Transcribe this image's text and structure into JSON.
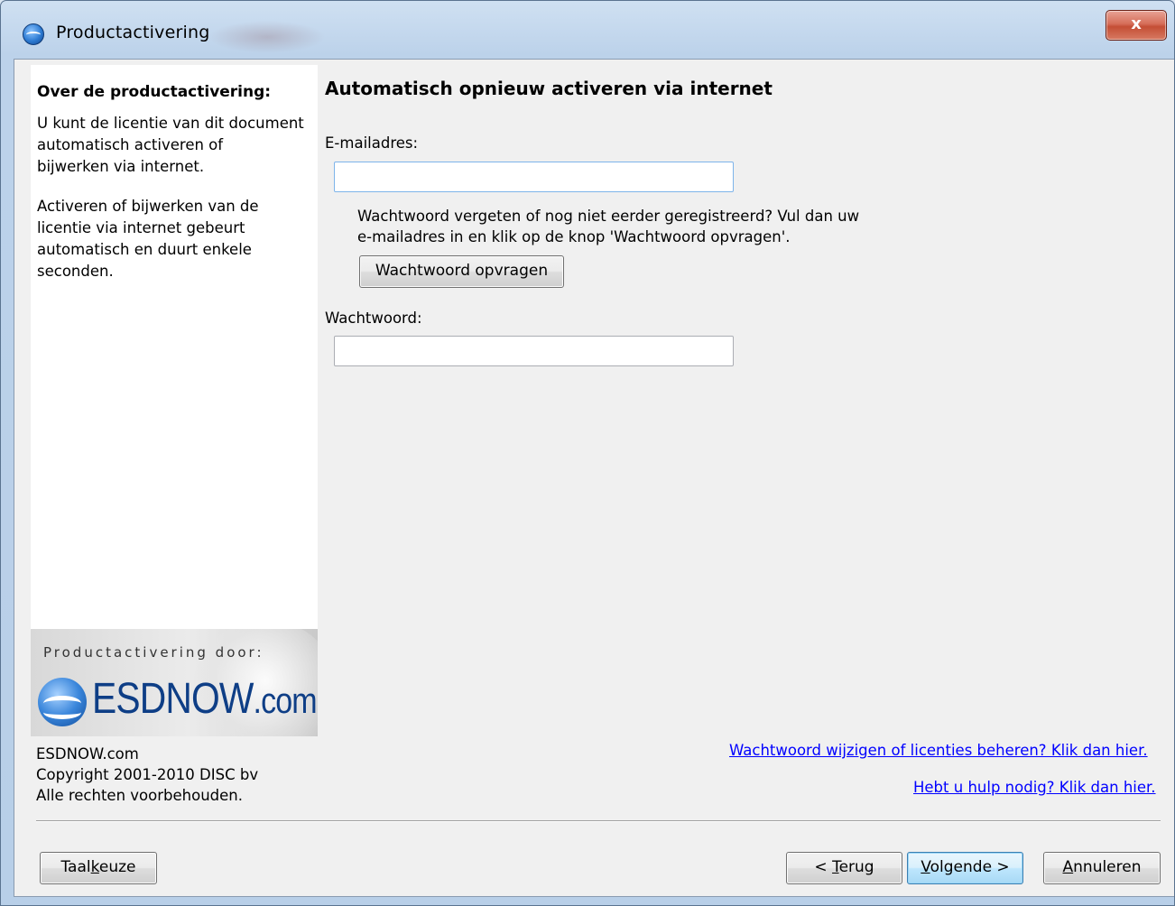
{
  "window": {
    "title": "Productactivering",
    "close_label": "x"
  },
  "sidebar": {
    "heading": "Over de productactivering:",
    "paragraph1": [
      "U kunt de licentie van dit document",
      "automatisch activeren of",
      "bijwerken via internet."
    ],
    "paragraph2": [
      "Activeren of bijwerken van de",
      "licentie via internet gebeurt",
      "automatisch en duurt enkele",
      "seconden."
    ],
    "logo": {
      "caption": "Productactivering door:",
      "brand": "ESDNOW",
      "brand_suffix": ".com"
    },
    "copyright": [
      "ESDNOW.com",
      "Copyright 2001-2010 DISC bv",
      "Alle rechten voorbehouden."
    ]
  },
  "main": {
    "title": "Automatisch opnieuw activeren via internet",
    "email_label": "E-mailadres:",
    "email_value": "",
    "help_text": [
      "Wachtwoord vergeten of nog niet eerder geregistreerd? Vul dan uw",
      "e-mailadres in en klik op de knop 'Wachtwoord opvragen'."
    ],
    "request_password_button": "Wachtwoord opvragen",
    "password_label": "Wachtwoord:",
    "password_value": "",
    "link_manage": "Wachtwoord wijzigen of licenties beheren? Klik dan hier.",
    "link_help": "Hebt u hulp nodig? Klik dan hier."
  },
  "footer": {
    "language_button": {
      "pre": "Taal",
      "accel": "k",
      "post": "euze"
    },
    "back_button": {
      "pre": "< ",
      "accel": "T",
      "post": "erug"
    },
    "next_button": {
      "pre": "",
      "accel": "V",
      "post": "olgende >"
    },
    "cancel_button": {
      "pre": "",
      "accel": "A",
      "post": "nnuleren"
    }
  }
}
